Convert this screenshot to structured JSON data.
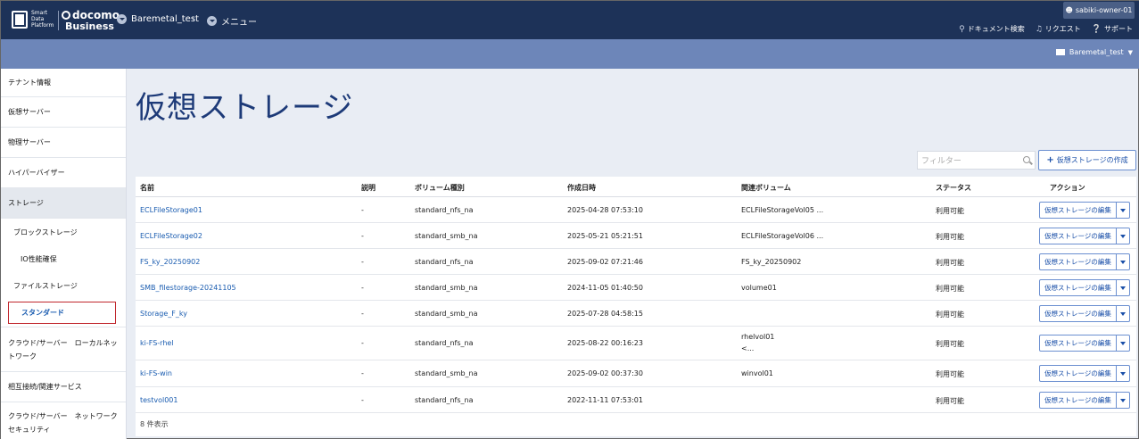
{
  "header": {
    "logo_text": "Smart\nData\nPlatform",
    "brand_top": "docomo",
    "brand_bottom": "Business",
    "crumb_tenant": "Baremetal_test",
    "crumb_menu": "メニュー",
    "user": "sabiki-owner-01",
    "doc_search": "ドキュメント検索",
    "request": "リクエスト",
    "support": "サポート"
  },
  "subbar": {
    "tenant": "Baremetal_test"
  },
  "sidebar": {
    "items": [
      {
        "label": "テナント情報"
      },
      {
        "label": "仮想サーバー"
      },
      {
        "label": "物理サーバー"
      },
      {
        "label": "ハイパーバイザー"
      },
      {
        "label": "ストレージ"
      },
      {
        "label": "ブロックストレージ"
      },
      {
        "label": "IO性能確保"
      },
      {
        "label": "ファイルストレージ"
      },
      {
        "label": "スタンダード"
      },
      {
        "label": "クラウド/サーバー　ローカルネットワーク"
      },
      {
        "label": "相互接続/関連サービス"
      },
      {
        "label": "クラウド/サーバー　ネットワークセキュリティ"
      }
    ]
  },
  "main": {
    "title": "仮想ストレージ",
    "filter_placeholder": "フィルター",
    "create_label": "仮想ストレージの作成",
    "columns": [
      "名前",
      "説明",
      "ボリューム種別",
      "作成日時",
      "関連ボリューム",
      "ステータス",
      "アクション"
    ],
    "rows": [
      {
        "name": "ECLFileStorage01",
        "desc": "-",
        "type": "standard_nfs_na",
        "created": "2025-04-28 07:53:10",
        "volume": "ECLFileStorageVol05 ...",
        "volume2": "",
        "status": "利用可能",
        "action": "仮想ストレージの編集"
      },
      {
        "name": "ECLFileStorage02",
        "desc": "-",
        "type": "standard_smb_na",
        "created": "2025-05-21 05:21:51",
        "volume": "ECLFileStorageVol06 ...",
        "volume2": "",
        "status": "利用可能",
        "action": "仮想ストレージの編集"
      },
      {
        "name": "FS_ky_20250902",
        "desc": "-",
        "type": "standard_nfs_na",
        "created": "2025-09-02 07:21:46",
        "volume": "FS_ky_20250902",
        "volume2": "",
        "status": "利用可能",
        "action": "仮想ストレージの編集"
      },
      {
        "name": "SMB_filestorage-20241105",
        "desc": "-",
        "type": "standard_smb_na",
        "created": "2024-11-05 01:40:50",
        "volume": "volume01",
        "volume2": "",
        "status": "利用可能",
        "action": "仮想ストレージの編集"
      },
      {
        "name": "Storage_F_ky",
        "desc": "-",
        "type": "standard_smb_na",
        "created": "2025-07-28 04:58:15",
        "volume": "",
        "volume2": "",
        "status": "利用可能",
        "action": "仮想ストレージの編集"
      },
      {
        "name": "ki-FS-rhel",
        "desc": "-",
        "type": "standard_nfs_na",
        "created": "2025-08-22 00:16:23",
        "volume": "rhelvol01",
        "volume2": "<...",
        "status": "利用可能",
        "action": "仮想ストレージの編集"
      },
      {
        "name": "ki-FS-win",
        "desc": "-",
        "type": "standard_smb_na",
        "created": "2025-09-02 00:37:30",
        "volume": "winvol01",
        "volume2": "",
        "status": "利用可能",
        "action": "仮想ストレージの編集"
      },
      {
        "name": "testvol001",
        "desc": "-",
        "type": "standard_nfs_na",
        "created": "2022-11-11 07:53:01",
        "volume": "",
        "volume2": "",
        "status": "利用可能",
        "action": "仮想ストレージの編集"
      }
    ],
    "count": "8 件表示"
  }
}
